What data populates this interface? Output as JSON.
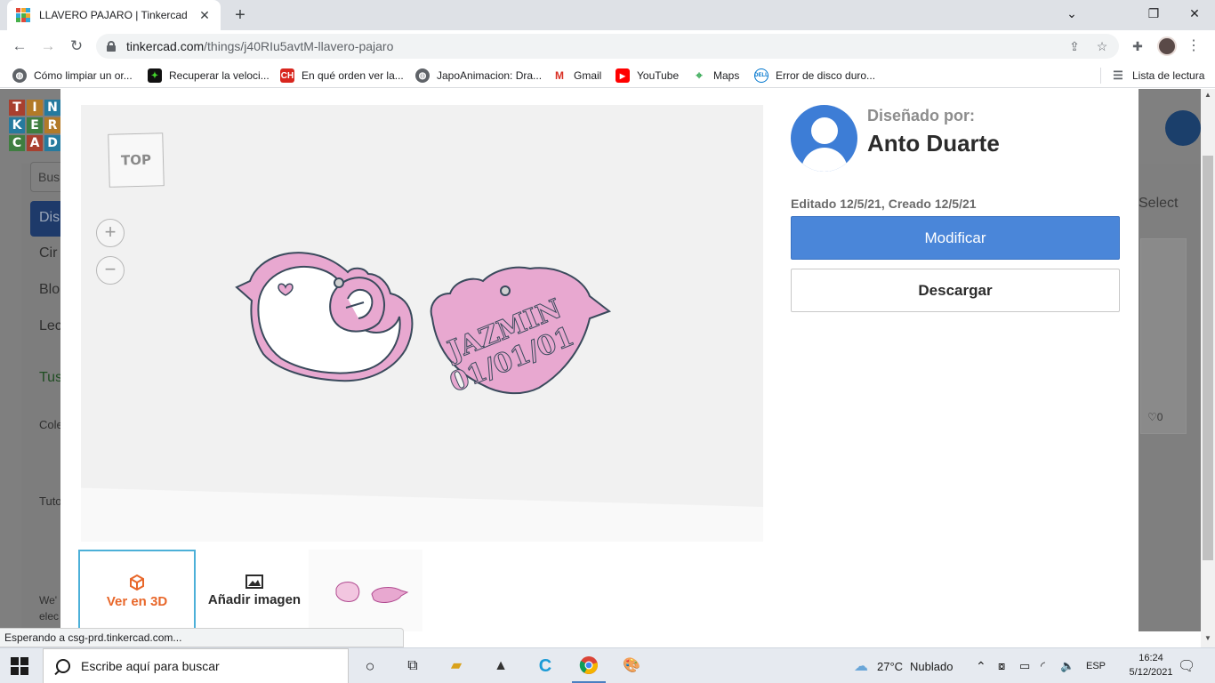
{
  "browser": {
    "tab_title": "LLAVERO PAJARO | Tinkercad",
    "url_host": "tinkercad.com",
    "url_path": "/things/j40RIu5avtM-llavero-pajaro",
    "bookmarks": [
      {
        "label": "Cómo limpiar un or...",
        "icon": "globe-icon"
      },
      {
        "label": "Recuperar la veloci...",
        "icon": "razer-icon"
      },
      {
        "label": "En qué orden ver la...",
        "icon": "ch-icon"
      },
      {
        "label": "JapoAnimacion: Dra...",
        "icon": "globe-icon"
      },
      {
        "label": "Gmail",
        "icon": "gmail-icon"
      },
      {
        "label": "YouTube",
        "icon": "youtube-icon"
      },
      {
        "label": "Maps",
        "icon": "maps-icon"
      },
      {
        "label": "Error de disco duro...",
        "icon": "dell-icon"
      }
    ],
    "reading_list": "Lista de lectura",
    "status_text": "Esperando a csg-prd.tinkercad.com..."
  },
  "background_page": {
    "logo_letters": [
      "T",
      "I",
      "N",
      "K",
      "E",
      "R",
      "C",
      "A",
      "D"
    ],
    "search_fragment": "Bus",
    "nav_items": [
      "Dis",
      "Cir",
      "Blo",
      "Lec"
    ],
    "your_label": "Tus",
    "collections_label": "Cole",
    "tutorials_label": "Tuto",
    "select_label": "Select",
    "heart_count": "0",
    "we_text": "We'",
    "elec_text": "elec"
  },
  "viewer": {
    "view_cube_label": "TOP",
    "zoom_in": "+",
    "zoom_out": "−",
    "tag_line1": "JAZMIN",
    "tag_line2": "01/01/01"
  },
  "thumbnails": {
    "view3d_label": "Ver en 3D",
    "add_image_label": "Añadir imagen"
  },
  "designer": {
    "designed_by_label": "Diseñado por:",
    "name": "Anto Duarte",
    "dates": "Editado 12/5/21, Creado 12/5/21"
  },
  "actions": {
    "modify_label": "Modificar",
    "download_label": "Descargar"
  },
  "taskbar": {
    "search_placeholder": "Escribe aquí para buscar",
    "weather_temp": "27°C",
    "weather_desc": "Nublado",
    "language": "ESP",
    "time": "16:24",
    "date": "5/12/2021"
  },
  "colors": {
    "accent_blue": "#4a86d9",
    "orange": "#e8672a",
    "bird_pink": "#e8a8d0",
    "outline": "#3a4a5c"
  }
}
